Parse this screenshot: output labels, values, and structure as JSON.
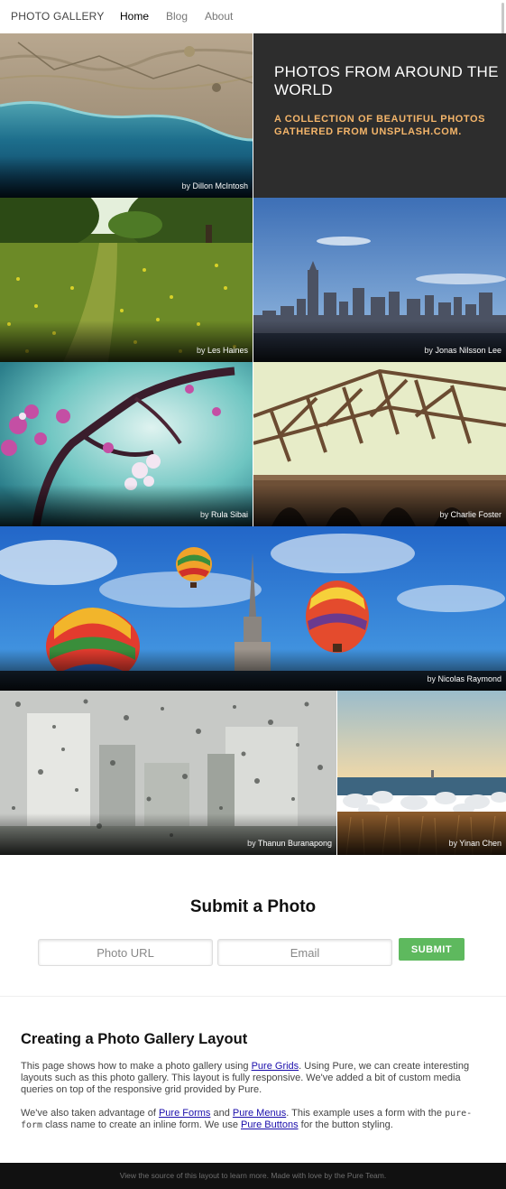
{
  "header": {
    "brand": "PHOTO GALLERY",
    "nav": [
      {
        "label": "Home",
        "selected": true
      },
      {
        "label": "Blog",
        "selected": false
      },
      {
        "label": "About",
        "selected": false
      }
    ]
  },
  "hero": {
    "title": "PHOTOS FROM AROUND THE WORLD",
    "subtitle": "A COLLECTION OF BEAUTIFUL PHOTOS GATHERED FROM UNSPLASH.COM."
  },
  "photos": [
    {
      "by": "by",
      "author": "Dillon McIntosh",
      "subject": "coastline-aerial"
    },
    {
      "by": "by",
      "author": "Les Haines",
      "subject": "flower-meadow"
    },
    {
      "by": "by",
      "author": "Jonas Nilsson Lee",
      "subject": "city-skyline"
    },
    {
      "by": "by",
      "author": "Rula Sibai",
      "subject": "cherry-blossoms"
    },
    {
      "by": "by",
      "author": "Charlie Foster",
      "subject": "steel-bridge"
    },
    {
      "by": "by",
      "author": "Nicolas Raymond",
      "subject": "hot-air-balloons"
    },
    {
      "by": "by",
      "author": "Thanun Buranapong",
      "subject": "rain-window"
    },
    {
      "by": "by",
      "author": "Yinan Chen",
      "subject": "rocky-shore"
    }
  ],
  "form": {
    "title": "Submit a Photo",
    "url_placeholder": "Photo URL",
    "email_placeholder": "Email",
    "submit_label": "SUBMIT"
  },
  "article": {
    "title": "Creating a Photo Gallery Layout",
    "p1_a": "This page shows how to make a photo gallery using ",
    "p1_link": "Pure Grids",
    "p1_b": ". Using Pure, we can create interesting layouts such as this photo gallery. This layout is fully responsive. We've added a bit of custom media queries on top of the responsive grid provided by Pure.",
    "p2_a": "We've also taken advantage of ",
    "p2_link1": "Pure Forms",
    "p2_b": " and ",
    "p2_link2": "Pure Menus",
    "p2_c": ". This example uses a form with the ",
    "p2_code": "pure-form",
    "p2_d": " class name to create an inline form. We use ",
    "p2_link3": "Pure Buttons",
    "p2_e": " for the button styling."
  },
  "footer": {
    "text": "View the source of this layout to learn more. Made with love by the Pure Team."
  },
  "colors": {
    "hero_bg": "#2d2d2d",
    "hero_subtitle": "#f4b56a",
    "submit_button": "#5eb95e",
    "footer_bg": "#111111",
    "link": "#1a0dab"
  }
}
